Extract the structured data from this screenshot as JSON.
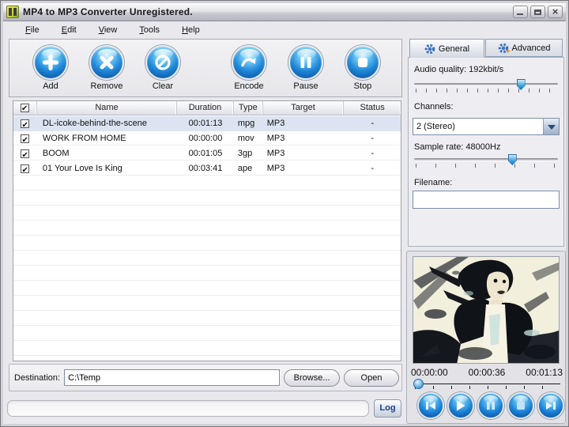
{
  "window": {
    "title": "MP4 to MP3 Converter Unregistered."
  },
  "menu": {
    "file": {
      "first": "F",
      "rest": "ile"
    },
    "edit": {
      "first": "E",
      "rest": "dit"
    },
    "view": {
      "first": "V",
      "rest": "iew"
    },
    "tools": {
      "first": "T",
      "rest": "ools"
    },
    "help": {
      "first": "H",
      "rest": "elp"
    }
  },
  "toolbar": {
    "buttons": [
      {
        "label": "Add",
        "icon": "plus-icon"
      },
      {
        "label": "Remove",
        "icon": "x-icon"
      },
      {
        "label": "Clear",
        "icon": "no-entry-icon"
      },
      {
        "label": "Encode",
        "icon": "curved-arrow-icon"
      },
      {
        "label": "Pause",
        "icon": "pause-icon"
      },
      {
        "label": "Stop",
        "icon": "stop-icon"
      }
    ]
  },
  "table": {
    "columns": {
      "name": "Name",
      "duration": "Duration",
      "type": "Type",
      "target": "Target",
      "status": "Status"
    },
    "rows": [
      {
        "checked": true,
        "selected": true,
        "name": "DL-icoke-behind-the-scene",
        "duration": "00:01:13",
        "type": "mpg",
        "target": "MP3",
        "status": "-"
      },
      {
        "checked": true,
        "selected": false,
        "name": "WORK FROM HOME",
        "duration": "00:00:00",
        "type": "mov",
        "target": "MP3",
        "status": "-"
      },
      {
        "checked": true,
        "selected": false,
        "name": "BOOM",
        "duration": "00:01:05",
        "type": "3gp",
        "target": "MP3",
        "status": "-"
      },
      {
        "checked": true,
        "selected": false,
        "name": "01 Your Love Is King",
        "duration": "00:03:41",
        "type": "ape",
        "target": "MP3",
        "status": "-"
      }
    ]
  },
  "destination": {
    "label": "Destination:",
    "value": "C:\\Temp",
    "browse_label": "Browse...",
    "open_label": "Open"
  },
  "statusbar": {
    "log_label": "Log"
  },
  "settings": {
    "tab_general": "General",
    "tab_advanced": "Advanced",
    "audio_quality_label": "Audio quality: 192kbit/s",
    "audio_quality_percent": 74,
    "channels_label": "Channels:",
    "channels_value": "2 (Stereo)",
    "sample_rate_label": "Sample rate: 48000Hz",
    "sample_rate_percent": 68,
    "filename_label": "Filename:",
    "filename_value": ""
  },
  "player": {
    "time_start": "00:00:00",
    "time_mid": "00:00:36",
    "time_end": "00:01:13",
    "position_percent": 3,
    "buttons": [
      "skip-back-icon",
      "play-icon",
      "pause-icon",
      "stop-icon",
      "skip-forward-icon"
    ]
  },
  "colors": {
    "accent_blue": "#1779cf",
    "selected_row": "#dce4f1",
    "log_text": "#1d3f8b"
  }
}
